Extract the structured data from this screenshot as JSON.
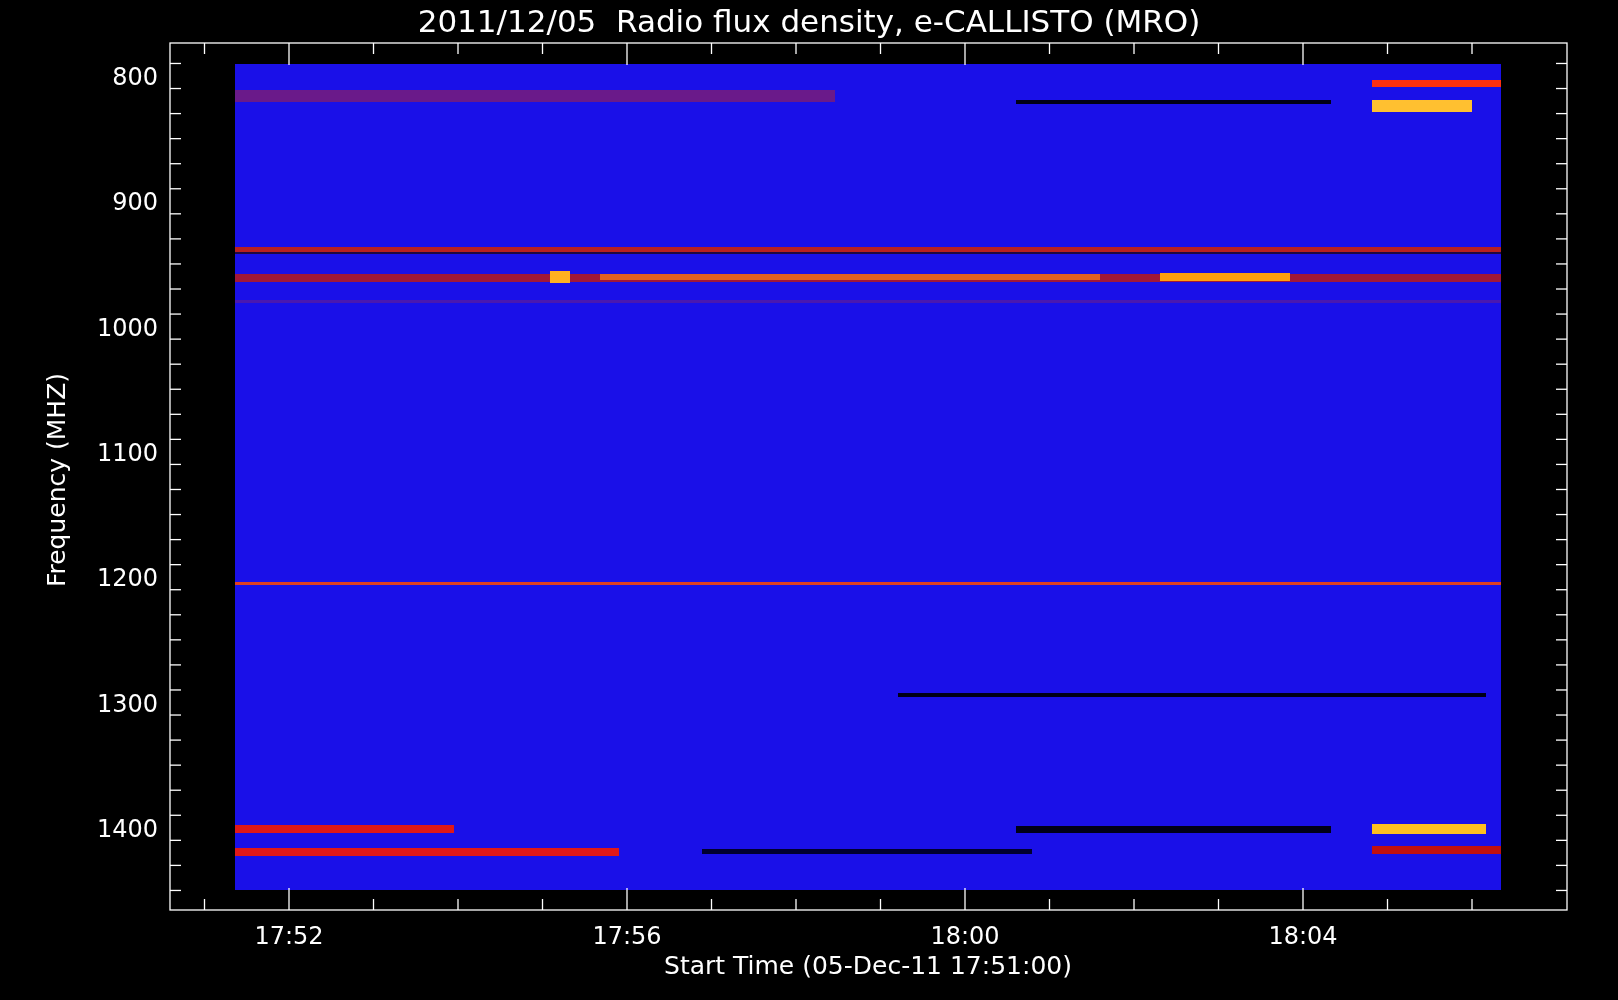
{
  "title": "2011/12/05  Radio flux density, e-CALLISTO (MRO)",
  "y_axis": {
    "label": "Frequency (MHZ)",
    "ticks": [
      "800",
      "900",
      "1000",
      "1100",
      "1200",
      "1300",
      "1400"
    ]
  },
  "x_axis": {
    "label": "Start Time (05-Dec-11 17:51:00)",
    "ticks": [
      "17:52",
      "17:56",
      "18:00",
      "18:04"
    ]
  }
}
